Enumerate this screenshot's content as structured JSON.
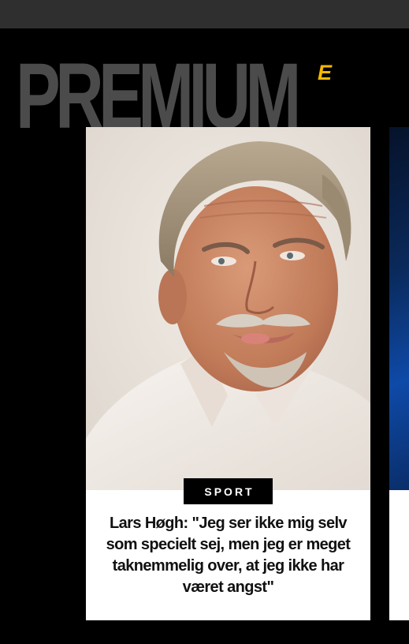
{
  "header": {
    "wordmark": "PREMIUM",
    "wordmark_badge": "E",
    "badge_color": "#f5b800"
  },
  "cards": [
    {
      "image_icon": "portrait-photo",
      "category": "SPORT",
      "title": "Lars Høgh: \"Jeg ser ikke mig selv som specielt sej, men jeg er meget taknemmelig over, at jeg ikke har været angst\""
    }
  ],
  "colors": {
    "background": "#000000",
    "top_bar": "#2f2f2f",
    "wordmark": "#4b4b4b",
    "card": "#ffffff",
    "badge_bg": "#000000"
  }
}
